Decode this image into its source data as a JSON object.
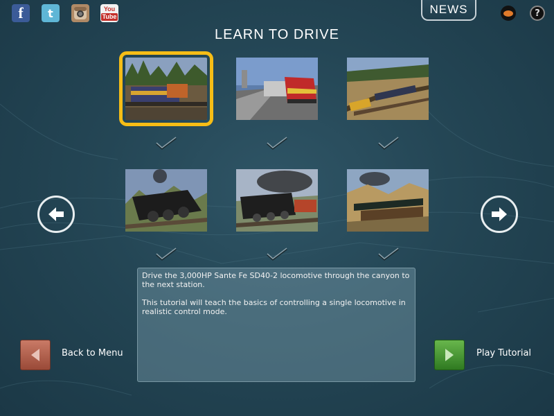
{
  "title": "LEARN TO DRIVE",
  "social": {
    "facebook": "f",
    "twitter": "t",
    "youtube_top": "You",
    "youtube_bottom": "Tube"
  },
  "header": {
    "news_label": "NEWS",
    "help_label": "?"
  },
  "tutorials": [
    {
      "id": 1,
      "selected": true,
      "completed": true
    },
    {
      "id": 2,
      "selected": false,
      "completed": true
    },
    {
      "id": 3,
      "selected": false,
      "completed": true
    },
    {
      "id": 4,
      "selected": false,
      "completed": true
    },
    {
      "id": 5,
      "selected": false,
      "completed": true
    },
    {
      "id": 6,
      "selected": false,
      "completed": true
    }
  ],
  "description": {
    "paragraph1": "Drive the 3,000HP Sante Fe SD40-2 locomotive through the canyon to the next station.",
    "paragraph2": "This tutorial will teach the basics of controlling a single locomotive in realistic control mode."
  },
  "footer": {
    "back_label": "Back to Menu",
    "play_label": "Play Tutorial"
  },
  "icons": {
    "prev": "arrow-left-icon",
    "next": "arrow-right-icon",
    "check": "checkmark-icon"
  },
  "colors": {
    "selected_outline": "#f6bd16",
    "back_button": "#b05a47",
    "play_button": "#4a9a35"
  }
}
